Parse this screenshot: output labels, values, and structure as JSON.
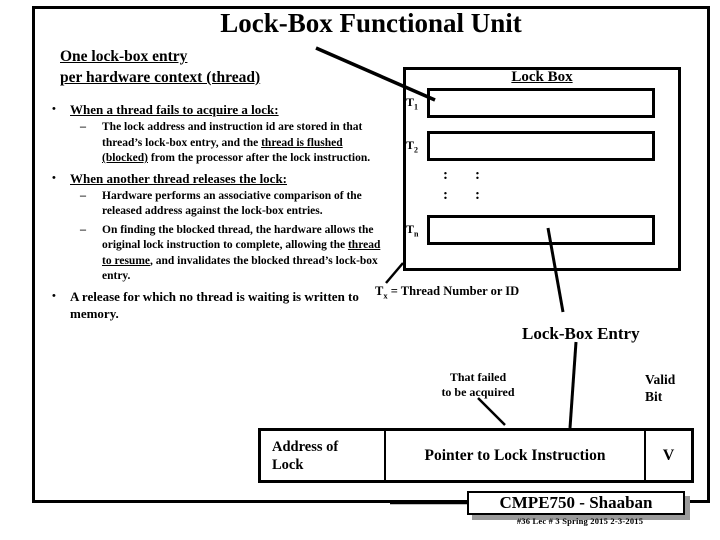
{
  "slide": {
    "title": "Lock-Box Functional Unit"
  },
  "left_heading": {
    "line1": "One lock-box entry",
    "line2": "per hardware context (thread)"
  },
  "bullets": [
    {
      "marker": "•",
      "text_pre": "",
      "text_underlined": "When a thread fails to acquire a lock:",
      "text_post": "",
      "sub": [
        {
          "marker": "–",
          "part1": "The lock address and instruction id are stored in that thread’s lock-box entry, and the ",
          "underlined": "thread is flushed (blocked)",
          "part2": " from the processor after the lock instruction."
        }
      ]
    },
    {
      "marker": "•",
      "text_pre": "",
      "text_underlined": "When another thread releases the lock:",
      "text_post": "",
      "sub": [
        {
          "marker": "–",
          "part1": " Hardware performs an associative comparison of the released address against the lock-box entries.",
          "underlined": "",
          "part2": ""
        },
        {
          "marker": "–",
          "part1": "On finding the blocked thread, the hardware allows the original lock instruction to complete, allowing the ",
          "underlined": "thread to resume",
          "part2": ", and invalidates the blocked thread’s lock-box entry."
        }
      ]
    },
    {
      "marker": "•",
      "text_pre": "A release for which no thread is waiting is written to memory.",
      "text_underlined": "",
      "text_post": "",
      "sub": []
    }
  ],
  "lock_box": {
    "title": "Lock Box",
    "rows": [
      {
        "label": "T",
        "sub": "1"
      },
      {
        "label": "T",
        "sub": "2"
      },
      {
        "label": "T",
        "sub": "n"
      }
    ],
    "vertical_dots": ":",
    "legend": "= Thread Number or ID",
    "legend_symbol": "T",
    "legend_sub": "x"
  },
  "entry": {
    "heading": "Lock-Box Entry",
    "callout_failed_line1": "That failed",
    "callout_failed_line2": "to be acquired",
    "callout_valid_line1": "Valid",
    "callout_valid_line2": "Bit",
    "cells": {
      "address_line1": "Address of",
      "address_line2": "Lock",
      "pointer": "Pointer to Lock Instruction",
      "valid": "V"
    }
  },
  "footer": {
    "banner": "CMPE750 - Shaaban",
    "fine_print": "#36   Lec # 3   Spring 2015   2-3-2015"
  },
  "colors": {
    "ink": "#000000",
    "paper": "#ffffff",
    "shadow": "#9a9a9a"
  }
}
